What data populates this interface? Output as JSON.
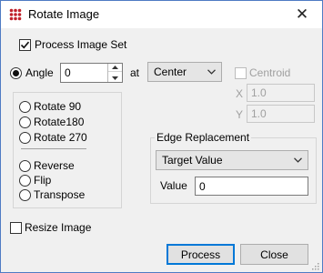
{
  "window": {
    "title": "Rotate Image",
    "close_glyph": "✕",
    "icon": "app-grid-icon"
  },
  "process_image_set": {
    "label": "Process Image Set",
    "checked": true
  },
  "angle": {
    "label": "Angle",
    "selected": true,
    "value": "0",
    "at_label": "at",
    "anchor_selected": "Center"
  },
  "centroid": {
    "label": "Centroid",
    "checked": false,
    "enabled": false
  },
  "coords": {
    "x_label": "X",
    "x_value": "1.0",
    "y_label": "Y",
    "y_value": "1.0"
  },
  "options": {
    "rotate_90": "Rotate 90",
    "rotate_180": "Rotate180",
    "rotate_270": "Rotate 270",
    "reverse": "Reverse",
    "flip": "Flip",
    "transpose": "Transpose"
  },
  "edge_replacement": {
    "title": "Edge Replacement",
    "mode_selected": "Target Value",
    "value_label": "Value",
    "value": "0"
  },
  "resize_image": {
    "label": "Resize Image",
    "checked": false
  },
  "buttons": {
    "process": "Process",
    "close": "Close"
  }
}
